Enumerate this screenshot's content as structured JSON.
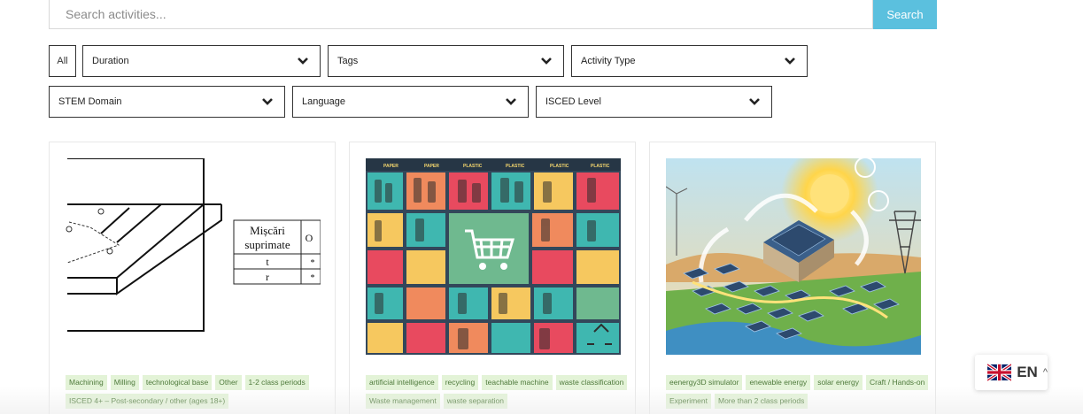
{
  "search": {
    "placeholder": "Search activities...",
    "button_label": "Search"
  },
  "filters": {
    "all_label": "All",
    "row1": [
      "Duration",
      "Tags",
      "Activity Type"
    ],
    "row2": [
      "STEM Domain",
      "Language",
      "ISCED Level"
    ]
  },
  "cards": [
    {
      "diagram": {
        "table_header_line1": "Mișcări",
        "table_header_line2": "suprimate",
        "col2": "O",
        "row1": "t",
        "row2": "r",
        "cell_mark": "*"
      },
      "tags": [
        "Machining",
        "Milling",
        "technological base",
        "Other",
        "1-2 class periods",
        "ISCED 4+ – Post-secondary / other (ages 18+)"
      ]
    },
    {
      "banner_words": [
        "PAPER",
        "PAPER",
        "PLASTIC",
        "PLASTIC",
        "PLASTIC",
        "PLASTIC"
      ],
      "tags": [
        "artificial intelligence",
        "recycling",
        "teachable machine",
        "waste classification",
        "Waste management",
        "waste separation"
      ]
    },
    {
      "tags": [
        "eenergy3D simulator",
        "enewable energy",
        "solar energy",
        "Craft / Hands-on",
        "Experiment",
        "More than 2 class periods"
      ]
    }
  ],
  "language": {
    "code": "EN",
    "flag_icon": "uk-flag-icon",
    "caret": "^"
  },
  "colors": {
    "search_button": "#5bc0de",
    "tag_bg": "#e3f3d7",
    "tag_text": "#4f7a3c"
  }
}
